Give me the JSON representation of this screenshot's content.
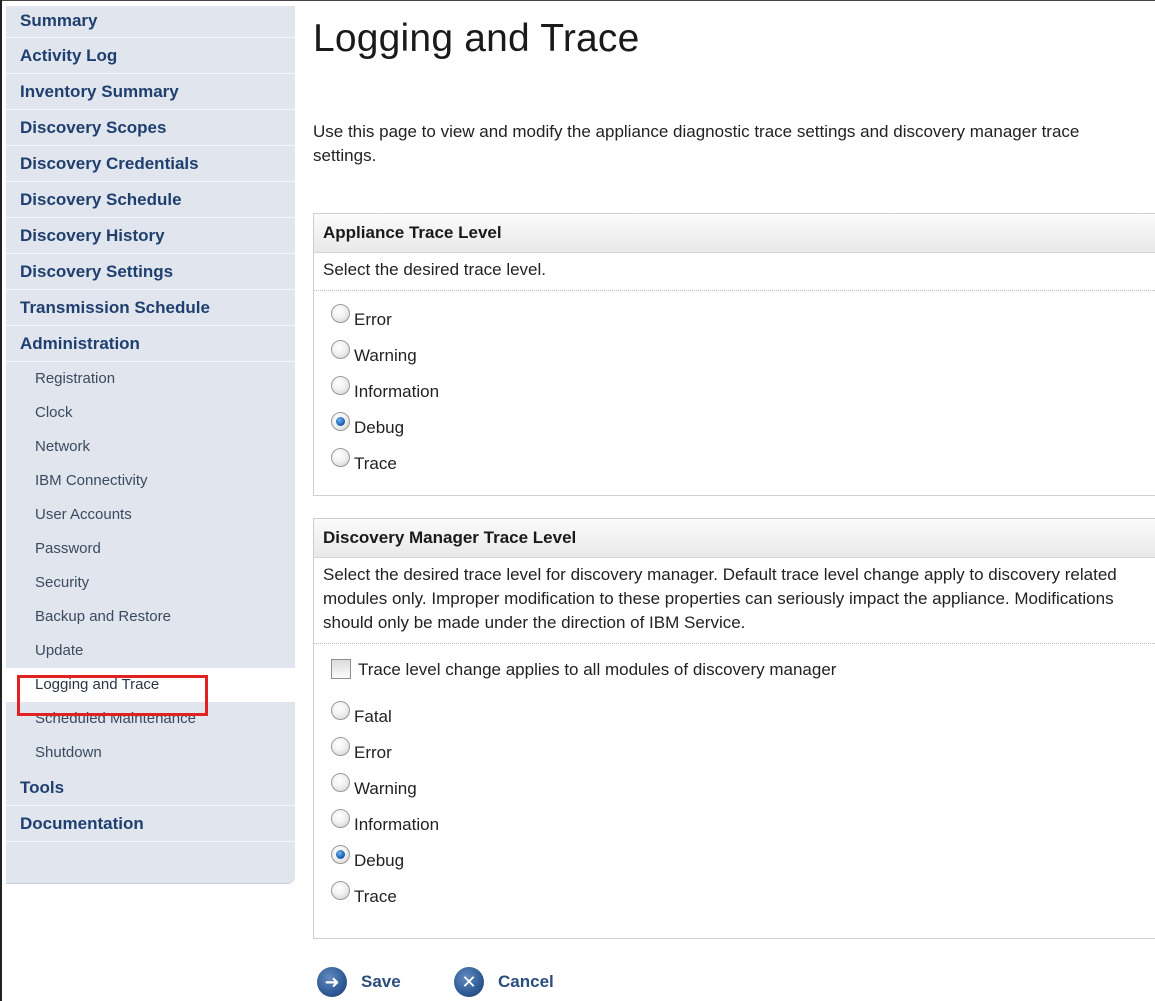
{
  "sidebar": {
    "main_items": [
      {
        "label": "Summary"
      },
      {
        "label": "Activity Log"
      },
      {
        "label": "Inventory Summary"
      },
      {
        "label": "Discovery Scopes"
      },
      {
        "label": "Discovery Credentials"
      },
      {
        "label": "Discovery Schedule"
      },
      {
        "label": "Discovery History"
      },
      {
        "label": "Discovery Settings"
      },
      {
        "label": "Transmission Schedule"
      },
      {
        "label": "Administration"
      }
    ],
    "admin_items": [
      {
        "label": "Registration"
      },
      {
        "label": "Clock"
      },
      {
        "label": "Network"
      },
      {
        "label": "IBM Connectivity"
      },
      {
        "label": "User Accounts"
      },
      {
        "label": "Password"
      },
      {
        "label": "Security"
      },
      {
        "label": "Backup and Restore"
      },
      {
        "label": "Update"
      },
      {
        "label": "Logging and Trace"
      },
      {
        "label": "Scheduled Maintenance"
      },
      {
        "label": "Shutdown"
      }
    ],
    "bottom_items": [
      {
        "label": "Tools"
      },
      {
        "label": "Documentation"
      }
    ],
    "active_item": "Logging and Trace"
  },
  "page": {
    "title": "Logging and Trace",
    "intro": "Use this page to view and modify the appliance diagnostic trace settings and discovery manager trace settings."
  },
  "appliance": {
    "heading": "Appliance Trace Level",
    "description": "Select the desired trace level.",
    "options": [
      "Error",
      "Warning",
      "Information",
      "Debug",
      "Trace"
    ],
    "selected": "Debug"
  },
  "discovery_manager": {
    "heading": "Discovery Manager Trace Level",
    "description": "Select the desired trace level for discovery manager. Default trace level change apply to discovery related modules only. Improper modification to these properties can seriously impact the appliance. Modifications should only be made under the direction of IBM Service.",
    "checkbox_label": "Trace level change applies to all modules of discovery manager",
    "checkbox_checked": false,
    "options": [
      "Fatal",
      "Error",
      "Warning",
      "Information",
      "Debug",
      "Trace"
    ],
    "selected": "Debug"
  },
  "actions": {
    "save_label": "Save",
    "save_icon": "arrow-right-icon",
    "cancel_label": "Cancel",
    "cancel_icon": "x-icon"
  }
}
